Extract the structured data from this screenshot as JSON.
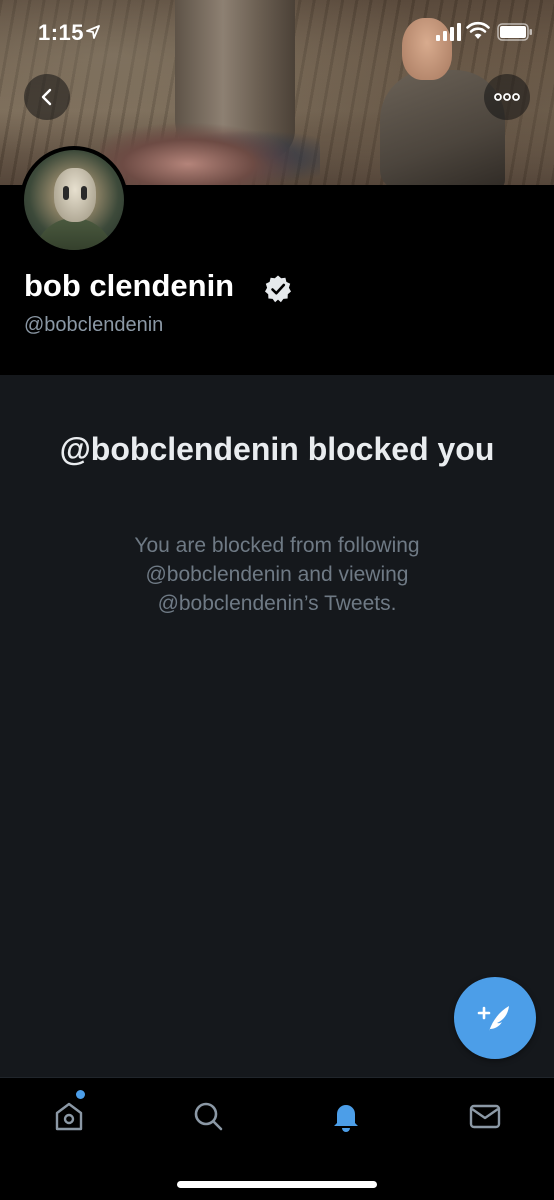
{
  "status_bar": {
    "time": "1:15"
  },
  "profile": {
    "display_name": "bob clendenin",
    "handle": "@bobclendenin",
    "verified": true
  },
  "blocked": {
    "title": "@bobclendenin blocked you",
    "description": "You are blocked from following @bobclendenin and viewing @bobclendenin’s Tweets."
  },
  "tabbar": {
    "items": [
      {
        "icon": "home-icon",
        "active": false,
        "has_dot": true
      },
      {
        "icon": "search-icon",
        "active": false
      },
      {
        "icon": "bell-icon",
        "active": true
      },
      {
        "icon": "mail-icon",
        "active": false
      }
    ]
  },
  "colors": {
    "accent": "#4c9ee8",
    "background": "#15181c",
    "header_bg": "#000000",
    "muted_text": "#8b98a5"
  }
}
